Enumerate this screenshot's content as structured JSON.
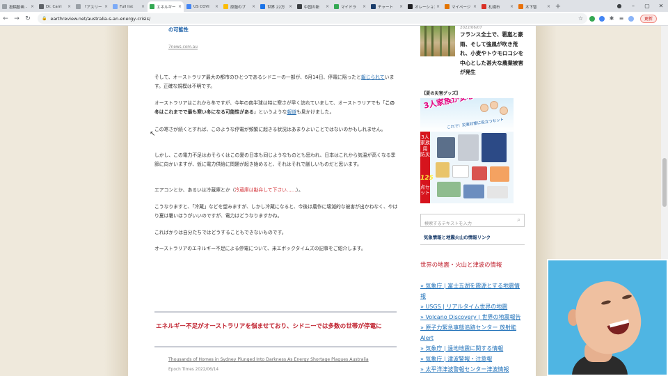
{
  "browser": {
    "tabs": [
      {
        "title": "投稿動画 -",
        "icon": "#9aa0a6",
        "active": false
      },
      {
        "title": "Dr. Carri",
        "icon": "#5f6368",
        "active": false
      },
      {
        "title": "「アスリー",
        "icon": "#9aa0a6",
        "active": false
      },
      {
        "title": "Full list",
        "icon": "#7baaf7",
        "active": false
      },
      {
        "title": "エネルギー",
        "icon": "#34a853",
        "active": true
      },
      {
        "title": "US COVI",
        "icon": "#4285f4",
        "active": false
      },
      {
        "title": "原題のブ",
        "icon": "#fbbc04",
        "active": false
      },
      {
        "title": "世界 22万",
        "icon": "#1a73e8",
        "active": false
      },
      {
        "title": "中国の新",
        "icon": "#3c4043",
        "active": false
      },
      {
        "title": "マイドラ",
        "icon": "#34a853",
        "active": false
      },
      {
        "title": "チャート",
        "icon": "#1a3d6b",
        "active": false
      },
      {
        "title": "オレーション",
        "icon": "#202124",
        "active": false
      },
      {
        "title": "マイページ",
        "icon": "#e37400",
        "active": false
      },
      {
        "title": "札幌市",
        "icon": "#d93025",
        "active": false
      },
      {
        "title": "木下智",
        "icon": "#e8710a",
        "active": false
      }
    ],
    "url": "earthreview.net/australia-s-an-energy-crisis/",
    "update_label": "更新"
  },
  "article": {
    "source_title": "の可能性",
    "source_site": "7news.com.au",
    "p1_a": "そして、オーストラリア最大の都市のひとつであるシドニーの一部が、6月14日、停電に陥ったと",
    "p1_link": "報じられて",
    "p1_b": "います。正確な規模は不明です。",
    "p2_a": "オーストラリアはこれから冬ですが、今年の南半球は特に寒さが早く訪れていまして、オーストラリアでも「",
    "p2_bold": "この冬はこれまでで最も寒い冬になる可能性がある",
    "p2_b": "」というような",
    "p2_link": "報道",
    "p2_c": "も見かけました。",
    "p3": "この寒さが続くとすれば、このような停電が頻繁に起きる状況はあまりよいことではないのかもしれません。",
    "p4": "しかし、この電力不足はおそらくはこの夏の日本も同じようなものとも思われ、日本はこれから気温が高くなる季節に向かいますが、仮に電力供給に問題が起き始めると、それはそれで厳しいものだと思います。",
    "p5_a": "エアコンとか、あるいは冷蔵庫とか（",
    "p5_red": "冷蔵庫は勘弁して下さい……",
    "p5_b": "）。",
    "p6": "こうなりますと、「冷蔵」などを望みますが、しかし冷蔵になると、今後は農作に壊滅的な被害が出かねなく、やはり夏は暑いほうがいいのですが、電力はどうなりますかね。",
    "p7": "こればかりは自分たちではどうすることもできないものです。",
    "p8": "オーストラリアのエネルギー不足による停電について、米エポックタイムズの記事をご紹介します。",
    "related_title": "エネルギー不足がオーストラリアを悩ませており、シドニーでは多数の世帯が停電に",
    "related_link": "Thousands of Homes in Sydney Plunged Into Darkness As Energy Shortage Plagues Australia",
    "related_source": "Epoch Times 2022/06/14"
  },
  "sidebar": {
    "news_date": "2022/06/07",
    "news_title": "フランス全土で、雹嵐と豪雨、そして強風が吹き荒れ、小麦やトウモロコシを中心とした甚大な農業被害が発生",
    "goods_label": "【夏の災害グッズ】",
    "ad_headline": "3人家族が安心の災害対策",
    "ad_sub": "これで！災害対策に役立つセット",
    "ad_band": "3人家族用 防災",
    "ad_band_num": "125",
    "ad_band_suffix": "点セット",
    "search_placeholder": "検索するテキストを入力",
    "quake_link": "気象情報と地震火山の情報リンク",
    "world_heading": "世界の地震・火山と津波の情報",
    "links": [
      "» 気象庁 | 富士五湖を震源とする地震情報",
      "» USGS | リアルタイム世界の地震",
      "» Volcano Discovery | 世界の地震報告",
      "» 原子力緊急事態追跡センター 放射能Alert",
      "» 気象庁 | 遠地地震に関する情報",
      "» 気象庁 | 津波警報・注意報",
      "» 太平洋津波警報センター津波情報"
    ]
  }
}
